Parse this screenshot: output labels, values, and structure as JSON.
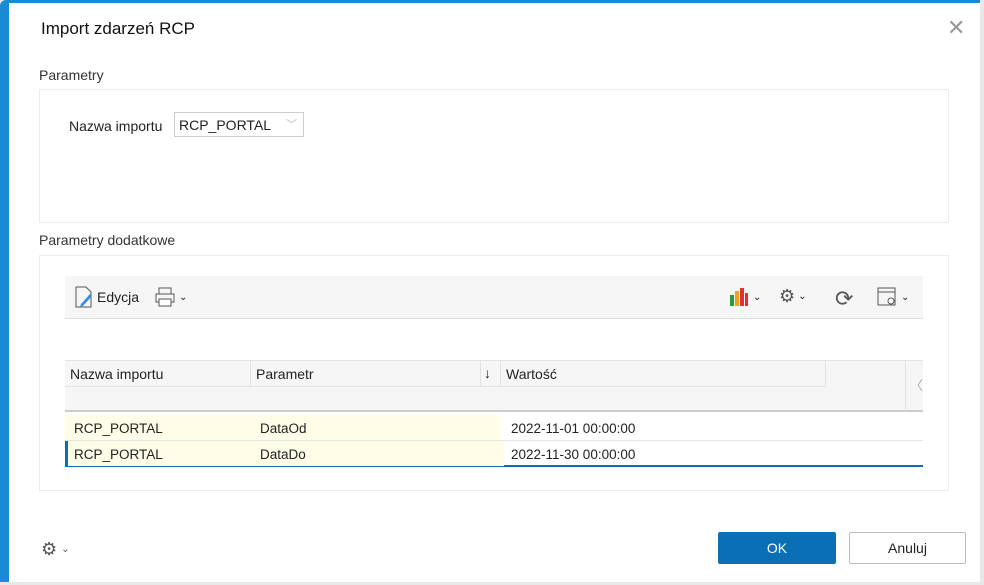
{
  "window": {
    "title": "Import zdarzeń RCP"
  },
  "parametry": {
    "section_label": "Parametry",
    "field_label": "Nazwa importu",
    "field_value": "RCP_PORTAL"
  },
  "dodatkowe": {
    "section_label": "Parametry dodatkowe",
    "toolbar": {
      "edit_label": "Edycja"
    },
    "columns": [
      "Nazwa importu",
      "Parametr",
      "Wartość"
    ],
    "rows": [
      {
        "name": "RCP_PORTAL",
        "param": "DataOd",
        "value": "2022-11-01 00:00:00"
      },
      {
        "name": "RCP_PORTAL",
        "param": "DataDo",
        "value": "2022-11-30 00:00:00"
      }
    ]
  },
  "footer": {
    "ok_label": "OK",
    "cancel_label": "Anuluj"
  },
  "colors": {
    "accent": "#1a8ad4",
    "primary_button": "#0a6fb4"
  }
}
